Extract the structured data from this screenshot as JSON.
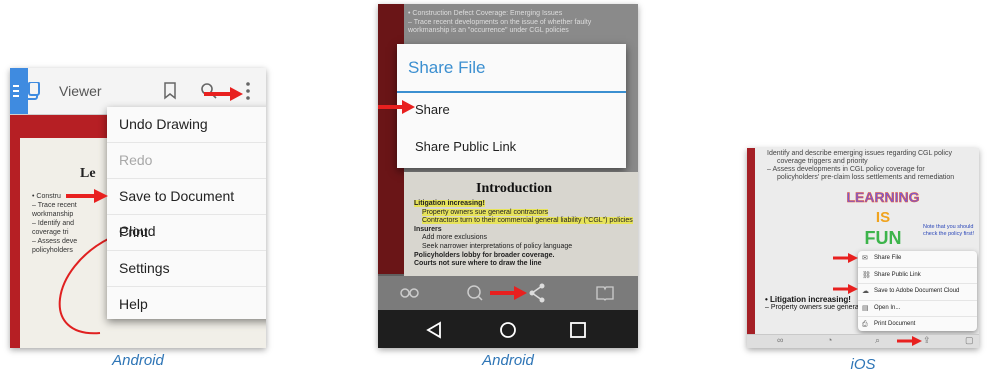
{
  "captions": [
    "Android",
    "Android",
    "iOS"
  ],
  "panel_a": {
    "toolbar_title": "Viewer",
    "slide_title": "Le",
    "slide_lines": [
      "• Constru",
      "  – Trace recent",
      "    workmanship",
      "  – Identify and",
      "    coverage tri",
      "  – Assess deve",
      "    policyholders"
    ],
    "menu": [
      "Undo Drawing",
      "Redo",
      "Save to Document Cloud",
      "Print",
      "Settings",
      "Help"
    ]
  },
  "panel_b": {
    "top_lines": [
      "• Construction Defect Coverage: Emerging Issues",
      "  – Trace recent developments on the issue of whether faulty",
      "    workmanship is an \"occurrence\" under CGL policies"
    ],
    "dialog_title": "Share File",
    "dialog_items": [
      "Share",
      "Share Public Link"
    ],
    "slide_title": "Introduction",
    "bullets": {
      "litigation": "Litigation increasing!",
      "sub1": "Property owners sue general contractors",
      "sub2": "Contractors turn to their commercial general liability (\"CGL\") policies",
      "insurers": "Insurers",
      "sub3": "Add more exclusions",
      "sub4": "Seek narrower interpretations of policy language",
      "lobby": "Policyholders lobby for broader coverage.",
      "courts": "Courts not sure where to draw the line"
    }
  },
  "panel_c": {
    "top_lines": [
      "Identify and describe emerging issues regarding CGL policy",
      "coverage triggers and priority",
      "– Assess developments in CGL policy coverage for",
      "policyholders' pre-claim loss settlements and remediation"
    ],
    "sticker": [
      "LEARNING",
      "IS",
      "FUN"
    ],
    "note": "Note that you should check the policy first!",
    "menu": [
      "Share File",
      "Share Public Link",
      "Save to Adobe Document Cloud",
      "Open In...",
      "Print Document"
    ],
    "lower_title": "In",
    "lower_lines": [
      "• Litigation increasing!",
      "  – Property owners sue general contractors"
    ]
  },
  "colors": {
    "arrow": "#e8201f",
    "accent_blue": "#3b8fd0",
    "caption_blue": "#2e75b6",
    "slide_red": "#b61f24"
  },
  "icons": [
    "menu-icon",
    "bookmark-icon",
    "search-icon",
    "overflow-menu-icon",
    "infinity-icon",
    "comment-icon",
    "share-icon",
    "book-icon",
    "back-icon",
    "home-icon",
    "recents-icon",
    "mail-icon",
    "link-icon",
    "cloud-icon",
    "open-in-icon",
    "print-icon"
  ]
}
